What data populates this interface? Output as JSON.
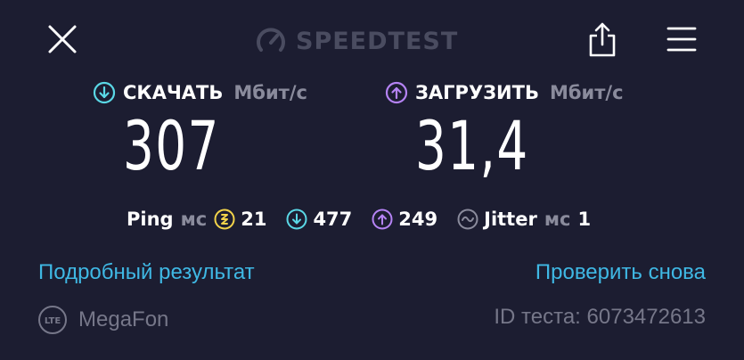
{
  "header": {
    "logo_text": "SPEEDTEST",
    "close_icon": "close-icon",
    "share_icon": "share-icon",
    "menu_icon": "menu-icon"
  },
  "download": {
    "label": "СКАЧАТЬ",
    "unit": "Мбит/с",
    "value": "307",
    "icon": "download-arrow-icon",
    "color": "#5ad8e6"
  },
  "upload": {
    "label": "ЗАГРУЗИТЬ",
    "unit": "Мбит/с",
    "value": "31,4",
    "icon": "upload-arrow-icon",
    "color": "#b583f5"
  },
  "ping": {
    "label": "Ping",
    "unit": "мс",
    "idle_value": "21",
    "download_value": "477",
    "upload_value": "249",
    "idle_color": "#f2d34a"
  },
  "jitter": {
    "label": "Jitter",
    "unit": "мс",
    "value": "1"
  },
  "links": {
    "detailed_result": "Подробный результат",
    "test_again": "Проверить снова"
  },
  "footer": {
    "network_badge": "LTE",
    "provider": "MegaFon",
    "test_id": "ID теста: 6073472613"
  }
}
